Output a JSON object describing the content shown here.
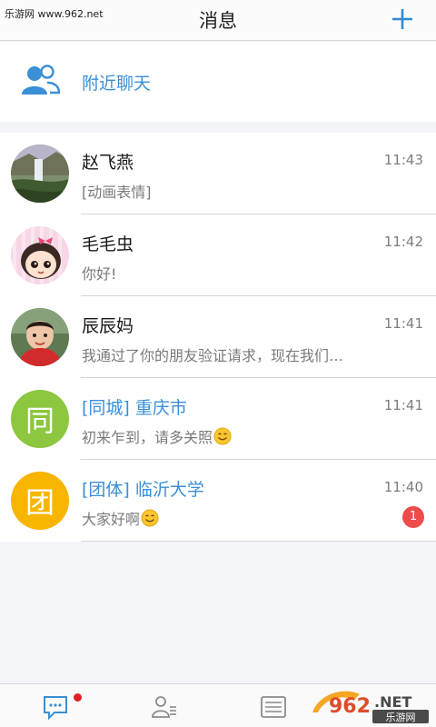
{
  "watermark": {
    "top_text": "乐游网 www.962.net"
  },
  "header": {
    "title": "消息"
  },
  "nearby": {
    "label": "附近聊天"
  },
  "conversations": [
    {
      "name": "赵飞燕",
      "time": "11:43",
      "message": "[动画表情]",
      "name_color": "default"
    },
    {
      "name": "毛毛虫",
      "time": "11:42",
      "message": "你好!",
      "name_color": "default"
    },
    {
      "name": "辰辰妈",
      "time": "11:41",
      "message": "我通过了你的朋友验证请求，现在我们…",
      "name_color": "default"
    },
    {
      "name": "[同城] 重庆市",
      "time": "11:41",
      "message": "初来乍到，请多关照",
      "avatar_letter": "同",
      "avatar_color": "#8dc63f",
      "name_color": "blue"
    },
    {
      "name": "[团体] 临沂大学",
      "time": "11:40",
      "message": "大家好啊",
      "avatar_letter": "团",
      "avatar_color": "#f7b500",
      "name_color": "blue",
      "unread": "1"
    }
  ],
  "logo": {
    "text_top": "962.NET",
    "text_bottom": "乐游网"
  },
  "colors": {
    "accent": "#3a8fd6",
    "badge": "#ef4b4b"
  }
}
